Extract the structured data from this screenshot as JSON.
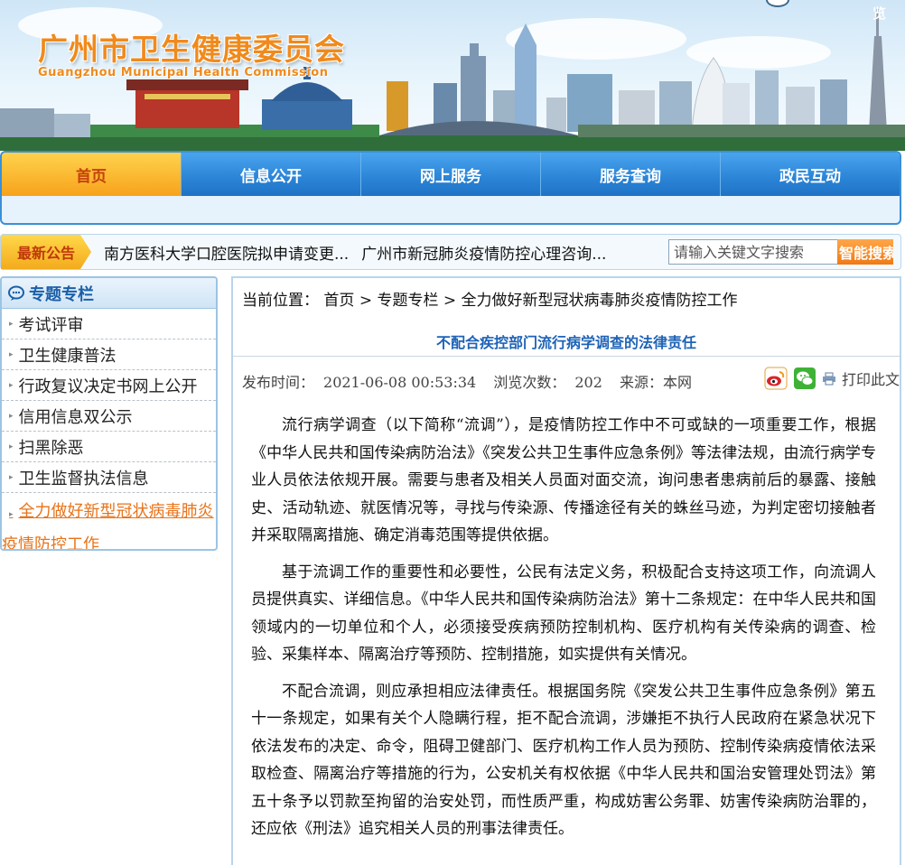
{
  "header": {
    "title": "广州市卫生健康委员会",
    "subtitle": "Guangzhou Municipal Health Commission",
    "corner_text": "览"
  },
  "nav": {
    "items": [
      {
        "label": "首页",
        "active": true
      },
      {
        "label": "信息公开"
      },
      {
        "label": "网上服务"
      },
      {
        "label": "服务查询"
      },
      {
        "label": "政民互动"
      }
    ]
  },
  "notice": {
    "label": "最新公告",
    "items": [
      "南方医科大学口腔医院拟申请变更...",
      "广州市新冠肺炎疫情防控心理咨询..."
    ],
    "search_placeholder": "请输入关键文字搜索",
    "search_button": "智能搜索"
  },
  "sidebar": {
    "title": "专题专栏",
    "items": [
      "考试评审",
      "卫生健康普法",
      "行政复议决定书网上公开",
      "信用信息双公示",
      "扫黑除恶",
      "卫生监督执法信息",
      "全力做好新型冠状病毒肺炎疫情防控工作"
    ],
    "active_index": 6
  },
  "breadcrumb": {
    "prefix": "当前位置：",
    "items": [
      "首页",
      "专题专栏",
      "全力做好新型冠状病毒肺炎疫情防控工作"
    ],
    "separator": ">"
  },
  "article": {
    "title": "不配合疾控部门流行病学调查的法律责任",
    "publish_label": "发布时间：",
    "publish_time": "2021-06-08 00:53:34",
    "views_label": "浏览次数：",
    "views": "202",
    "source_label": "来源：",
    "source": "本网",
    "print_label": "打印此文",
    "paragraphs": [
      "流行病学调查（以下简称“流调”），是疫情防控工作中不可或缺的一项重要工作，根据《中华人民共和国传染病防治法》《突发公共卫生事件应急条例》等法律法规，由流行病学专业人员依法依规开展。需要与患者及相关人员面对面交流，询问患者患病前后的暴露、接触史、活动轨迹、就医情况等，寻找与传染源、传播途径有关的蛛丝马迹，为判定密切接触者并采取隔离措施、确定消毒范围等提供依据。",
      "基于流调工作的重要性和必要性，公民有法定义务，积极配合支持这项工作，向流调人员提供真实、详细信息。《中华人民共和国传染病防治法》第十二条规定：在中华人民共和国领域内的一切单位和个人，必须接受疾病预防控制机构、医疗机构有关传染病的调查、检验、采集样本、隔离治疗等预防、控制措施，如实提供有关情况。",
      "不配合流调，则应承担相应法律责任。根据国务院《突发公共卫生事件应急条例》第五十一条规定，如果有关个人隐瞒行程，拒不配合流调，涉嫌拒不执行人民政府在紧急状况下依法发布的决定、命令，阻碍卫健部门、医疗机构工作人员为预防、控制传染病疫情依法采取检查、隔离治疗等措施的行为，公安机关有权依据《中华人民共和国治安管理处罚法》第五十条予以罚款至拘留的治安处罚，而性质严重，构成妨害公务罪、妨害传染病防治罪的，还应依《刑法》追究相关人员的刑事法律责任。"
    ]
  },
  "colors": {
    "nav_blue": "#2d86d8",
    "nav_active": "#f7a21b",
    "title_orange": "#f08a1c",
    "link_blue": "#1e63b7",
    "active_link": "#e8731a"
  },
  "icons": {
    "sidebar": "chat-bubble-icon",
    "weibo": "weibo-icon",
    "wechat": "wechat-icon",
    "print": "printer-icon"
  }
}
